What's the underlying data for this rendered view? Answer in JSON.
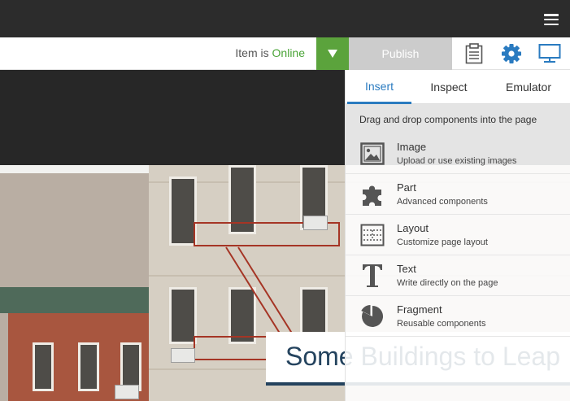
{
  "toolbar": {
    "status_prefix": "Item is",
    "status_value": "Online",
    "publish_label": "Publish",
    "icons": [
      "menu-icon",
      "clipboard-icon",
      "gear-icon",
      "monitor-icon",
      "chevron-down-icon"
    ]
  },
  "colors": {
    "accent_blue": "#2a7bc0",
    "online_green": "#4aa437",
    "publish_dropdown_green": "#5ba33c",
    "headline_navy": "#24435e"
  },
  "page": {
    "headline": "Some Buildings to Leap"
  },
  "panel": {
    "tabs": [
      {
        "label": "Insert",
        "active": true
      },
      {
        "label": "Inspect",
        "active": false
      },
      {
        "label": "Emulator",
        "active": false
      }
    ],
    "hint": "Drag and drop components into the page",
    "components": [
      {
        "title": "Image",
        "description": "Upload or use existing images",
        "icon": "image-icon"
      },
      {
        "title": "Part",
        "description": "Advanced components",
        "icon": "puzzle-icon"
      },
      {
        "title": "Layout",
        "description": "Customize page layout",
        "icon": "layout-icon"
      },
      {
        "title": "Text",
        "description": "Write directly on the page",
        "icon": "text-icon"
      },
      {
        "title": "Fragment",
        "description": "Reusable components",
        "icon": "pie-icon"
      }
    ]
  }
}
